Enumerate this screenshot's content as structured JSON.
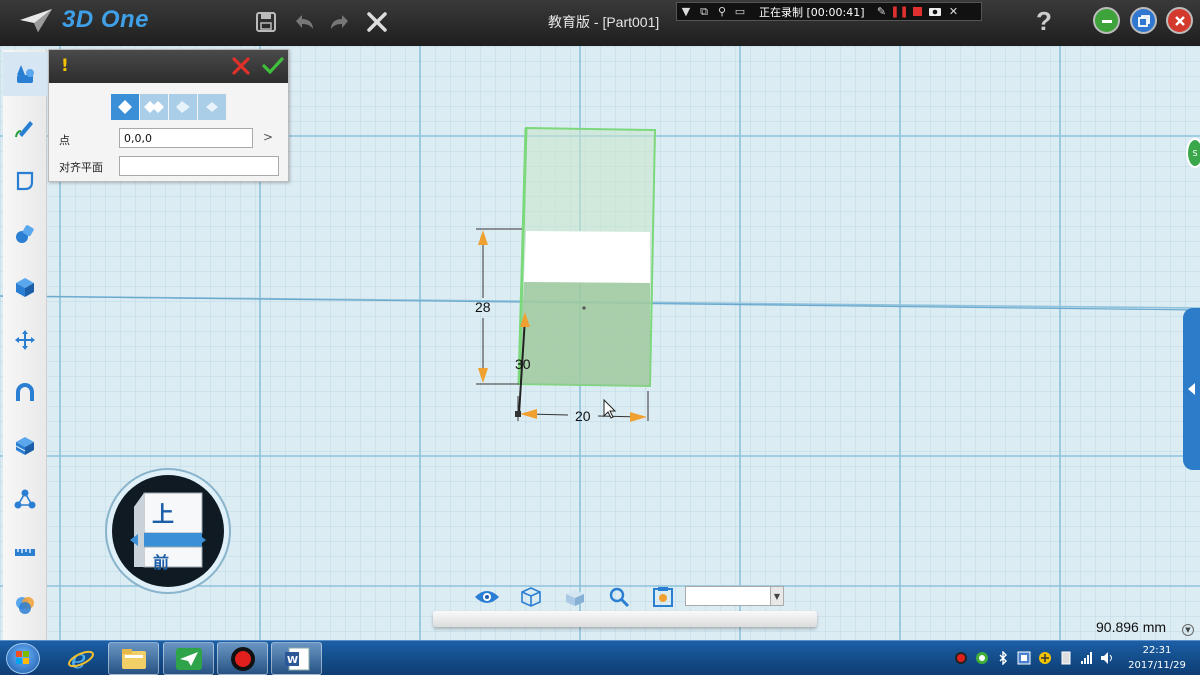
{
  "app": {
    "name": "3D One",
    "document_title": "教育版 - [Part001]"
  },
  "recording": {
    "status": "正在录制 [00:00:41]"
  },
  "titlebar_icons": [
    "save-icon",
    "undo-icon",
    "redo-icon",
    "close-icon",
    "help-icon"
  ],
  "help_label": "?",
  "panel": {
    "warning_mark": "!",
    "fields": [
      {
        "label": "点",
        "value": "0,0,0"
      },
      {
        "label": "对齐平面",
        "value": ""
      }
    ],
    "more_symbol": ">"
  },
  "dimensions": {
    "height": "28",
    "depth": "30",
    "width": "20"
  },
  "view_cube": {
    "top_label": "上",
    "front_label": "前"
  },
  "view_select": {
    "value": ""
  },
  "readout": {
    "value": "90.896 mm"
  },
  "colors": {
    "accent_blue": "#3b8fd6",
    "cube_green": "#8fd68f",
    "dimension_orange": "#f0a030",
    "grid_bg": "#dcecf3"
  },
  "taskbar": {
    "apps": [
      "internet-explorer-icon",
      "file-explorer-icon",
      "3d-one-icon",
      "recorder-icon",
      "word-icon"
    ],
    "clock_time": "22:31",
    "clock_date": "2017/11/29"
  }
}
